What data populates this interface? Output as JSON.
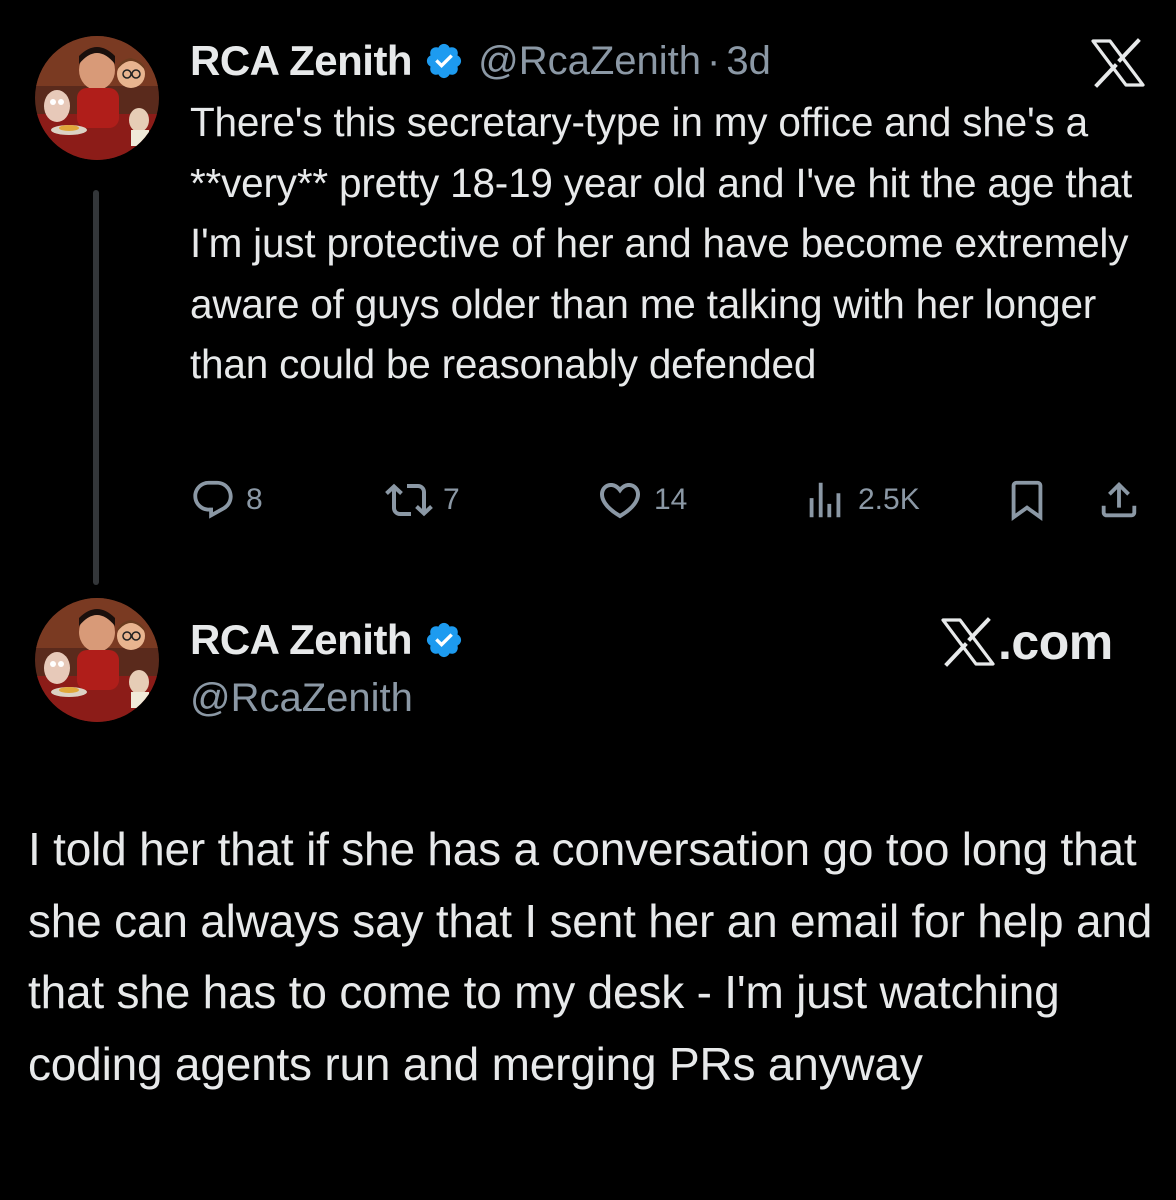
{
  "tweet": {
    "author": {
      "name": "RCA Zenith",
      "handle": "@RcaZenith",
      "verified": true
    },
    "separator": "·",
    "time": "3d",
    "text": "There's this secretary-type in my office and she's a **very** pretty 18-19 year old and I've hit the age that I'm just protective of her and have become extremely aware of guys older than me talking with her longer than could be reasonably defended",
    "actions": {
      "replies": "8",
      "retweets": "7",
      "likes": "14",
      "views": "2.5K"
    },
    "platform_logo": "x-logo"
  },
  "reply_card": {
    "author": {
      "name": "RCA Zenith",
      "handle": "@RcaZenith",
      "verified": true
    },
    "brand": ".com",
    "text": "I told her that if she has a conversation go too long that she can always say that I sent her an email for help and that she has to come to my desk - I'm just watching coding agents run and merging PRs anyway"
  },
  "colors": {
    "background": "#000000",
    "primary_text": "#e7e9ea",
    "secondary_text": "#8b98a5",
    "verified_blue": "#1d9bf0",
    "thread_line": "#333639"
  },
  "icons": [
    "reply-icon",
    "retweet-icon",
    "like-icon",
    "views-icon",
    "bookmark-icon",
    "share-icon",
    "verified-badge-icon",
    "x-logo-icon"
  ]
}
